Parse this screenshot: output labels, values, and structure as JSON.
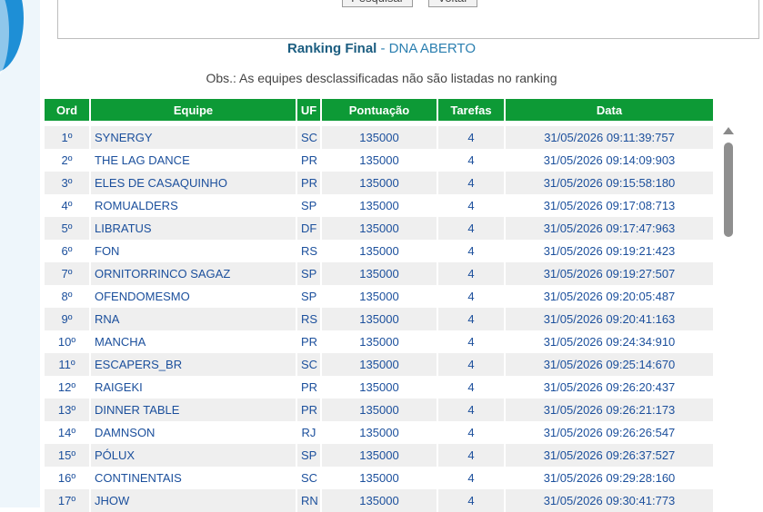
{
  "search_panel": {
    "search_label": "Pesquisar",
    "back_label": "Voltar"
  },
  "heading": {
    "title": "Ranking Final",
    "separator": " - ",
    "subtitle": "DNA ABERTO"
  },
  "note": "Obs.: As equipes desclassificadas não são listadas no ranking",
  "table": {
    "headers": [
      "Ord",
      "Equipe",
      "UF",
      "Pontuação",
      "Tarefas",
      "Data"
    ],
    "rows": [
      [
        "1º",
        "SYNERGY",
        "SC",
        "135000",
        "4",
        "31/05/2026 09:11:39:757"
      ],
      [
        "2º",
        "THE LAG DANCE",
        "PR",
        "135000",
        "4",
        "31/05/2026 09:14:09:903"
      ],
      [
        "3º",
        "ELES DE CASAQUINHO",
        "PR",
        "135000",
        "4",
        "31/05/2026 09:15:58:180"
      ],
      [
        "4º",
        "ROMUALDERS",
        "SP",
        "135000",
        "4",
        "31/05/2026 09:17:08:713"
      ],
      [
        "5º",
        "LIBRATUS",
        "DF",
        "135000",
        "4",
        "31/05/2026 09:17:47:963"
      ],
      [
        "6º",
        "FON",
        "RS",
        "135000",
        "4",
        "31/05/2026 09:19:21:423"
      ],
      [
        "7º",
        "ORNITORRINCO SAGAZ",
        "SP",
        "135000",
        "4",
        "31/05/2026 09:19:27:507"
      ],
      [
        "8º",
        "OFENDOMESMO",
        "SP",
        "135000",
        "4",
        "31/05/2026 09:20:05:487"
      ],
      [
        "9º",
        "RNA",
        "RS",
        "135000",
        "4",
        "31/05/2026 09:20:41:163"
      ],
      [
        "10º",
        "MANCHA",
        "PR",
        "135000",
        "4",
        "31/05/2026 09:24:34:910"
      ],
      [
        "11º",
        "ESCAPERS_BR",
        "SC",
        "135000",
        "4",
        "31/05/2026 09:25:14:670"
      ],
      [
        "12º",
        "RAIGEKI",
        "PR",
        "135000",
        "4",
        "31/05/2026 09:26:20:437"
      ],
      [
        "13º",
        "DINNER TABLE",
        "PR",
        "135000",
        "4",
        "31/05/2026 09:26:21:173"
      ],
      [
        "14º",
        "DAMNSON",
        "RJ",
        "135000",
        "4",
        "31/05/2026 09:26:26:547"
      ],
      [
        "15º",
        "PÓLUX",
        "SP",
        "135000",
        "4",
        "31/05/2026 09:26:37:527"
      ],
      [
        "16º",
        "CONTINENTAIS",
        "SC",
        "135000",
        "4",
        "31/05/2026 09:29:28:160"
      ],
      [
        "17º",
        "JHOW",
        "RN",
        "135000",
        "4",
        "31/05/2026 09:30:41:773"
      ]
    ]
  },
  "colors": {
    "header_green": "#0d9a36",
    "link_blue": "#1b4f9c",
    "stripe": "#efefef"
  },
  "icons": {
    "scroll_up": "triangle-up"
  }
}
